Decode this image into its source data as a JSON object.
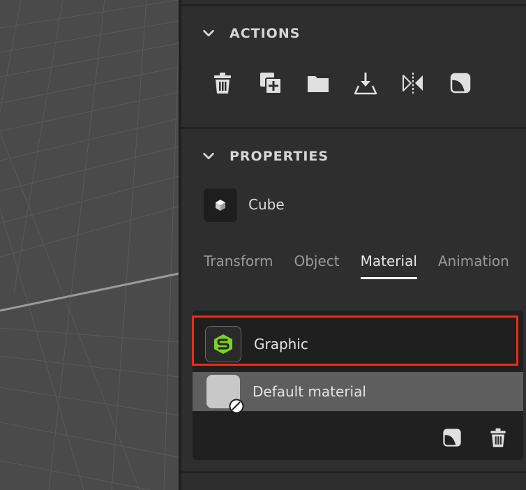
{
  "actions": {
    "title": "ACTIONS",
    "buttons": [
      {
        "icon": "trash-icon"
      },
      {
        "icon": "duplicate-icon"
      },
      {
        "icon": "folder-icon"
      },
      {
        "icon": "drop-to-ground-icon"
      },
      {
        "icon": "mirror-icon"
      },
      {
        "icon": "apply-material-icon"
      }
    ]
  },
  "properties": {
    "title": "PROPERTIES",
    "object_name": "Cube",
    "tabs": [
      "Transform",
      "Object",
      "Material",
      "Animation"
    ],
    "active_tab": "Material"
  },
  "materials": {
    "items": [
      {
        "label": "Graphic",
        "selected": true
      },
      {
        "label": "Default material",
        "selected": false
      }
    ]
  },
  "colors": {
    "highlight": "#ef2b12",
    "graphic_logo": "#7ed321",
    "panel_bg": "#2e2e2e"
  }
}
